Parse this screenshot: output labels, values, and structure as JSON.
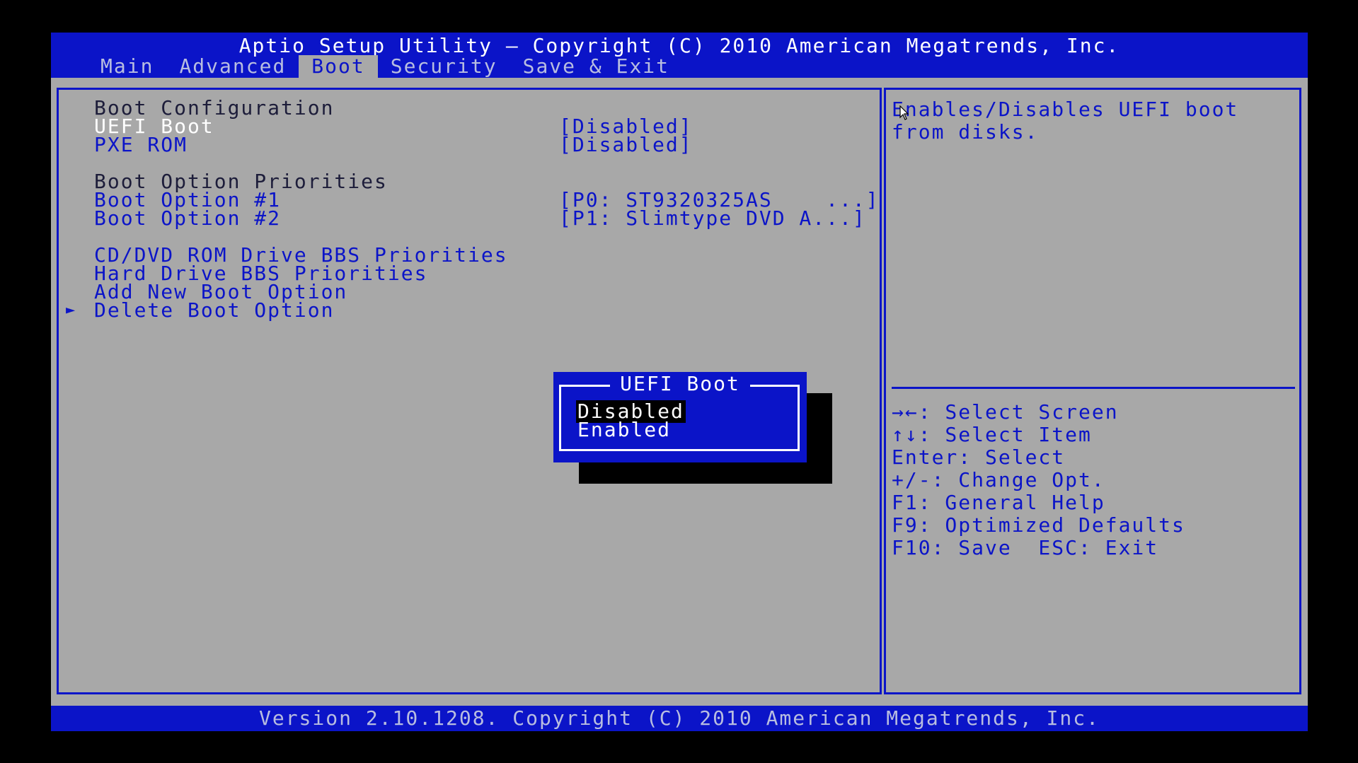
{
  "header": {
    "title": "Aptio Setup Utility – Copyright (C) 2010 American Megatrends, Inc.",
    "tabs": [
      {
        "label": "Main"
      },
      {
        "label": "Advanced"
      },
      {
        "label": "Boot",
        "active": true
      },
      {
        "label": "Security"
      },
      {
        "label": "Save & Exit"
      }
    ]
  },
  "boot": {
    "config_heading": "Boot Configuration",
    "uefi_boot": {
      "label": "UEFI Boot",
      "value": "[Disabled]"
    },
    "pxe_rom": {
      "label": "PXE ROM",
      "value": "[Disabled]"
    },
    "priorities_heading": "Boot Option Priorities",
    "boot_option_1": {
      "label": "Boot Option #1",
      "value": "[P0: ST9320325AS    ...]"
    },
    "boot_option_2": {
      "label": "Boot Option #2",
      "value": "[P1: Slimtype DVD A...]"
    },
    "cd_dvd_bbs": "CD/DVD ROM Drive BBS Priorities",
    "hdd_bbs": "Hard Drive BBS Priorities",
    "add_new": "Add New Boot Option",
    "delete": "Delete Boot Option",
    "arrow_glyph": "►"
  },
  "popup": {
    "title": "UEFI Boot",
    "options": [
      "Disabled",
      "Enabled"
    ],
    "selected": "Disabled"
  },
  "help": {
    "description_line1": "Enables/Disables UEFI boot",
    "description_line2": "from disks.",
    "keys": [
      "→←: Select Screen",
      "↑↓: Select Item",
      "Enter: Select",
      "+/-: Change Opt.",
      "F1: General Help",
      "F9: Optimized Defaults",
      "F10: Save  ESC: Exit"
    ]
  },
  "footer": {
    "text": "Version 2.10.1208. Copyright (C) 2010 American Megatrends, Inc."
  },
  "colors": {
    "accent": "#0b14c8",
    "panel": "#a8a8a8",
    "background": "#000000"
  }
}
